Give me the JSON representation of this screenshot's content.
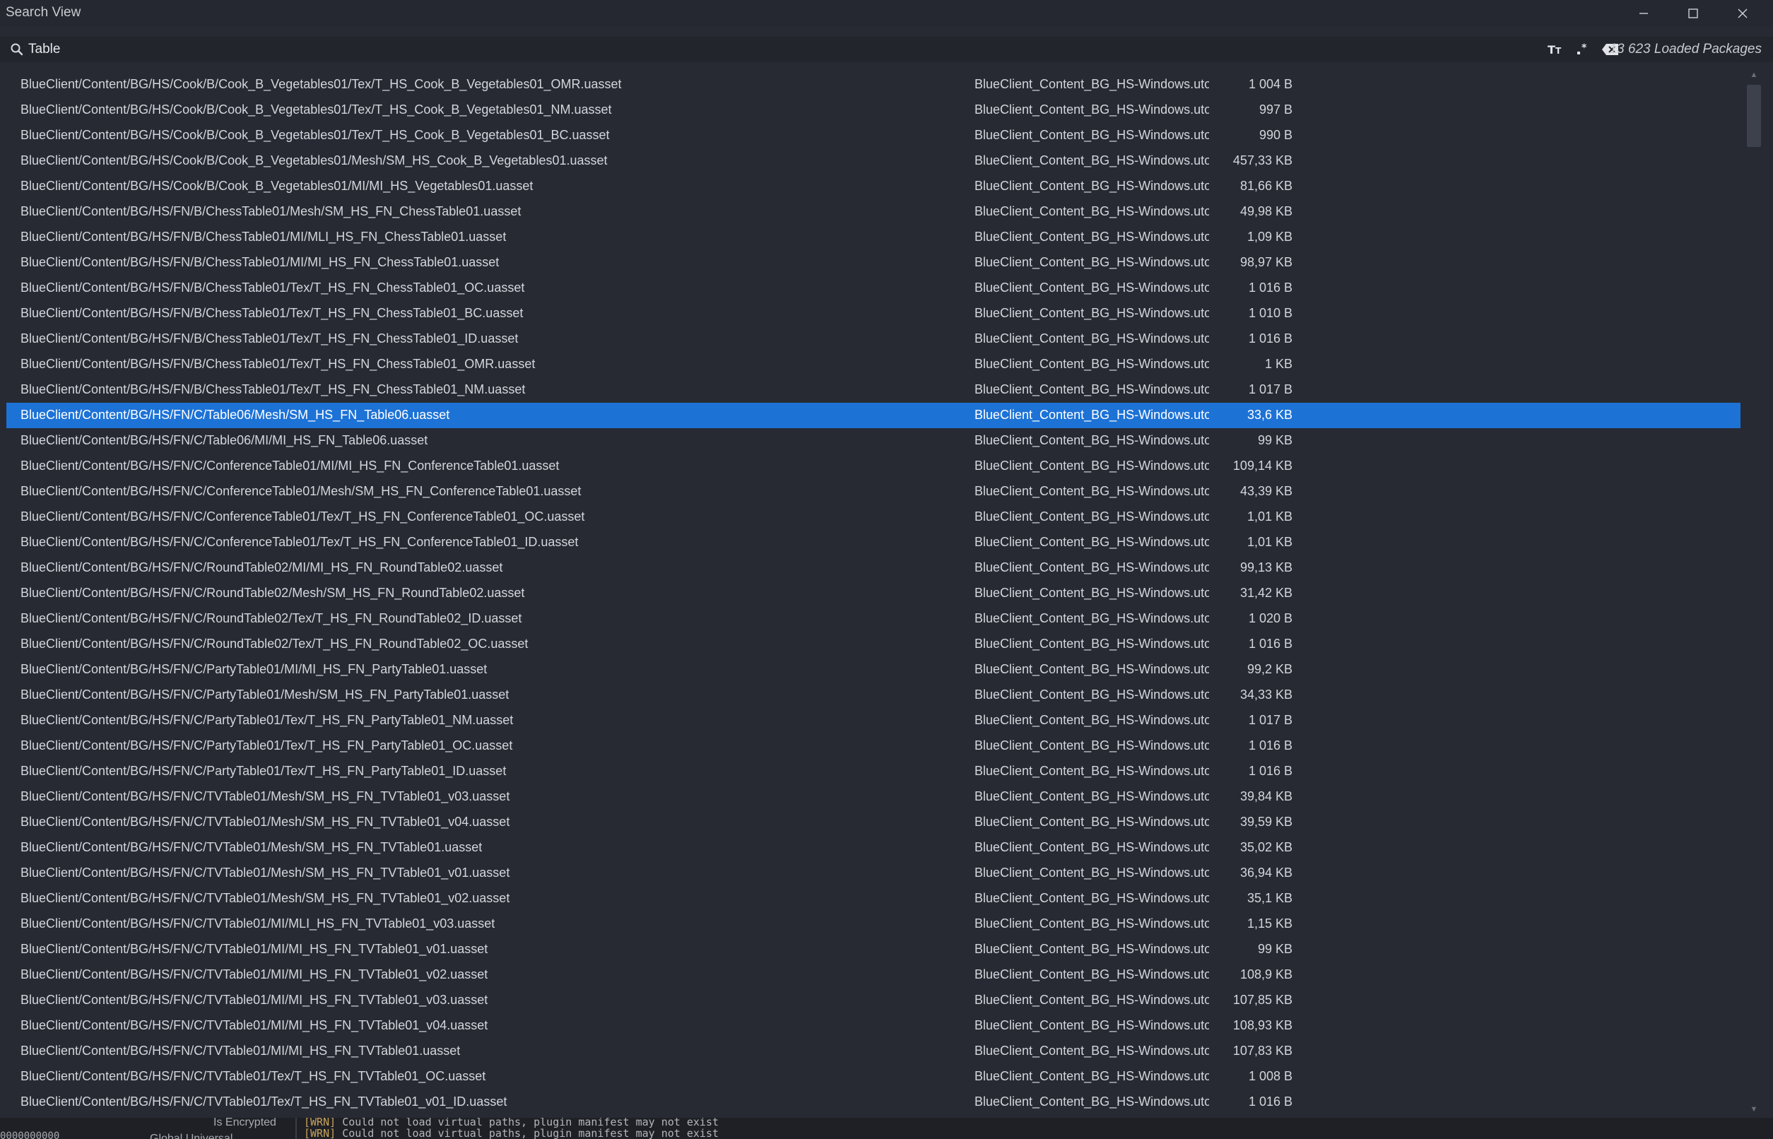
{
  "window": {
    "title": "Search View",
    "minimize_icon": "minimize-icon",
    "maximize_icon": "maximize-icon",
    "close_icon": "close-icon"
  },
  "search": {
    "icon": "search-icon",
    "value": "Table",
    "placeholder": "",
    "match_case_icon": "text-case-icon",
    "regex_icon": "regex-icon",
    "clear_icon": "backspace-clear-icon",
    "loaded_packages": "13 623 Loaded Packages"
  },
  "results": {
    "selected_index": 13,
    "rows": [
      {
        "path": "BlueClient/Content/BG/HS/Cook/B/Cook_B_Vegetables01/Tex/T_HS_Cook_B_Vegetables01_OMR.uasset",
        "package": "BlueClient_Content_BG_HS-Windows.utoc",
        "size": "1 004 B"
      },
      {
        "path": "BlueClient/Content/BG/HS/Cook/B/Cook_B_Vegetables01/Tex/T_HS_Cook_B_Vegetables01_NM.uasset",
        "package": "BlueClient_Content_BG_HS-Windows.utoc",
        "size": "997 B"
      },
      {
        "path": "BlueClient/Content/BG/HS/Cook/B/Cook_B_Vegetables01/Tex/T_HS_Cook_B_Vegetables01_BC.uasset",
        "package": "BlueClient_Content_BG_HS-Windows.utoc",
        "size": "990 B"
      },
      {
        "path": "BlueClient/Content/BG/HS/Cook/B/Cook_B_Vegetables01/Mesh/SM_HS_Cook_B_Vegetables01.uasset",
        "package": "BlueClient_Content_BG_HS-Windows.utoc",
        "size": "457,33 KB"
      },
      {
        "path": "BlueClient/Content/BG/HS/Cook/B/Cook_B_Vegetables01/MI/MI_HS_Vegetables01.uasset",
        "package": "BlueClient_Content_BG_HS-Windows.utoc",
        "size": "81,66 KB"
      },
      {
        "path": "BlueClient/Content/BG/HS/FN/B/ChessTable01/Mesh/SM_HS_FN_ChessTable01.uasset",
        "package": "BlueClient_Content_BG_HS-Windows.utoc",
        "size": "49,98 KB"
      },
      {
        "path": "BlueClient/Content/BG/HS/FN/B/ChessTable01/MI/MLI_HS_FN_ChessTable01.uasset",
        "package": "BlueClient_Content_BG_HS-Windows.utoc",
        "size": "1,09 KB"
      },
      {
        "path": "BlueClient/Content/BG/HS/FN/B/ChessTable01/MI/MI_HS_FN_ChessTable01.uasset",
        "package": "BlueClient_Content_BG_HS-Windows.utoc",
        "size": "98,97 KB"
      },
      {
        "path": "BlueClient/Content/BG/HS/FN/B/ChessTable01/Tex/T_HS_FN_ChessTable01_OC.uasset",
        "package": "BlueClient_Content_BG_HS-Windows.utoc",
        "size": "1 016 B"
      },
      {
        "path": "BlueClient/Content/BG/HS/FN/B/ChessTable01/Tex/T_HS_FN_ChessTable01_BC.uasset",
        "package": "BlueClient_Content_BG_HS-Windows.utoc",
        "size": "1 010 B"
      },
      {
        "path": "BlueClient/Content/BG/HS/FN/B/ChessTable01/Tex/T_HS_FN_ChessTable01_ID.uasset",
        "package": "BlueClient_Content_BG_HS-Windows.utoc",
        "size": "1 016 B"
      },
      {
        "path": "BlueClient/Content/BG/HS/FN/B/ChessTable01/Tex/T_HS_FN_ChessTable01_OMR.uasset",
        "package": "BlueClient_Content_BG_HS-Windows.utoc",
        "size": "1 KB"
      },
      {
        "path": "BlueClient/Content/BG/HS/FN/B/ChessTable01/Tex/T_HS_FN_ChessTable01_NM.uasset",
        "package": "BlueClient_Content_BG_HS-Windows.utoc",
        "size": "1 017 B"
      },
      {
        "path": "BlueClient/Content/BG/HS/FN/C/Table06/Mesh/SM_HS_FN_Table06.uasset",
        "package": "BlueClient_Content_BG_HS-Windows.utoc",
        "size": "33,6 KB"
      },
      {
        "path": "BlueClient/Content/BG/HS/FN/C/Table06/MI/MI_HS_FN_Table06.uasset",
        "package": "BlueClient_Content_BG_HS-Windows.utoc",
        "size": "99 KB"
      },
      {
        "path": "BlueClient/Content/BG/HS/FN/C/ConferenceTable01/MI/MI_HS_FN_ConferenceTable01.uasset",
        "package": "BlueClient_Content_BG_HS-Windows.utoc",
        "size": "109,14 KB"
      },
      {
        "path": "BlueClient/Content/BG/HS/FN/C/ConferenceTable01/Mesh/SM_HS_FN_ConferenceTable01.uasset",
        "package": "BlueClient_Content_BG_HS-Windows.utoc",
        "size": "43,39 KB"
      },
      {
        "path": "BlueClient/Content/BG/HS/FN/C/ConferenceTable01/Tex/T_HS_FN_ConferenceTable01_OC.uasset",
        "package": "BlueClient_Content_BG_HS-Windows.utoc",
        "size": "1,01 KB"
      },
      {
        "path": "BlueClient/Content/BG/HS/FN/C/ConferenceTable01/Tex/T_HS_FN_ConferenceTable01_ID.uasset",
        "package": "BlueClient_Content_BG_HS-Windows.utoc",
        "size": "1,01 KB"
      },
      {
        "path": "BlueClient/Content/BG/HS/FN/C/RoundTable02/MI/MI_HS_FN_RoundTable02.uasset",
        "package": "BlueClient_Content_BG_HS-Windows.utoc",
        "size": "99,13 KB"
      },
      {
        "path": "BlueClient/Content/BG/HS/FN/C/RoundTable02/Mesh/SM_HS_FN_RoundTable02.uasset",
        "package": "BlueClient_Content_BG_HS-Windows.utoc",
        "size": "31,42 KB"
      },
      {
        "path": "BlueClient/Content/BG/HS/FN/C/RoundTable02/Tex/T_HS_FN_RoundTable02_ID.uasset",
        "package": "BlueClient_Content_BG_HS-Windows.utoc",
        "size": "1 020 B"
      },
      {
        "path": "BlueClient/Content/BG/HS/FN/C/RoundTable02/Tex/T_HS_FN_RoundTable02_OC.uasset",
        "package": "BlueClient_Content_BG_HS-Windows.utoc",
        "size": "1 016 B"
      },
      {
        "path": "BlueClient/Content/BG/HS/FN/C/PartyTable01/MI/MI_HS_FN_PartyTable01.uasset",
        "package": "BlueClient_Content_BG_HS-Windows.utoc",
        "size": "99,2 KB"
      },
      {
        "path": "BlueClient/Content/BG/HS/FN/C/PartyTable01/Mesh/SM_HS_FN_PartyTable01.uasset",
        "package": "BlueClient_Content_BG_HS-Windows.utoc",
        "size": "34,33 KB"
      },
      {
        "path": "BlueClient/Content/BG/HS/FN/C/PartyTable01/Tex/T_HS_FN_PartyTable01_NM.uasset",
        "package": "BlueClient_Content_BG_HS-Windows.utoc",
        "size": "1 017 B"
      },
      {
        "path": "BlueClient/Content/BG/HS/FN/C/PartyTable01/Tex/T_HS_FN_PartyTable01_OC.uasset",
        "package": "BlueClient_Content_BG_HS-Windows.utoc",
        "size": "1 016 B"
      },
      {
        "path": "BlueClient/Content/BG/HS/FN/C/PartyTable01/Tex/T_HS_FN_PartyTable01_ID.uasset",
        "package": "BlueClient_Content_BG_HS-Windows.utoc",
        "size": "1 016 B"
      },
      {
        "path": "BlueClient/Content/BG/HS/FN/C/TVTable01/Mesh/SM_HS_FN_TVTable01_v03.uasset",
        "package": "BlueClient_Content_BG_HS-Windows.utoc",
        "size": "39,84 KB"
      },
      {
        "path": "BlueClient/Content/BG/HS/FN/C/TVTable01/Mesh/SM_HS_FN_TVTable01_v04.uasset",
        "package": "BlueClient_Content_BG_HS-Windows.utoc",
        "size": "39,59 KB"
      },
      {
        "path": "BlueClient/Content/BG/HS/FN/C/TVTable01/Mesh/SM_HS_FN_TVTable01.uasset",
        "package": "BlueClient_Content_BG_HS-Windows.utoc",
        "size": "35,02 KB"
      },
      {
        "path": "BlueClient/Content/BG/HS/FN/C/TVTable01/Mesh/SM_HS_FN_TVTable01_v01.uasset",
        "package": "BlueClient_Content_BG_HS-Windows.utoc",
        "size": "36,94 KB"
      },
      {
        "path": "BlueClient/Content/BG/HS/FN/C/TVTable01/Mesh/SM_HS_FN_TVTable01_v02.uasset",
        "package": "BlueClient_Content_BG_HS-Windows.utoc",
        "size": "35,1 KB"
      },
      {
        "path": "BlueClient/Content/BG/HS/FN/C/TVTable01/MI/MLI_HS_FN_TVTable01_v03.uasset",
        "package": "BlueClient_Content_BG_HS-Windows.utoc",
        "size": "1,15 KB"
      },
      {
        "path": "BlueClient/Content/BG/HS/FN/C/TVTable01/MI/MI_HS_FN_TVTable01_v01.uasset",
        "package": "BlueClient_Content_BG_HS-Windows.utoc",
        "size": "99 KB"
      },
      {
        "path": "BlueClient/Content/BG/HS/FN/C/TVTable01/MI/MI_HS_FN_TVTable01_v02.uasset",
        "package": "BlueClient_Content_BG_HS-Windows.utoc",
        "size": "108,9 KB"
      },
      {
        "path": "BlueClient/Content/BG/HS/FN/C/TVTable01/MI/MI_HS_FN_TVTable01_v03.uasset",
        "package": "BlueClient_Content_BG_HS-Windows.utoc",
        "size": "107,85 KB"
      },
      {
        "path": "BlueClient/Content/BG/HS/FN/C/TVTable01/MI/MI_HS_FN_TVTable01_v04.uasset",
        "package": "BlueClient_Content_BG_HS-Windows.utoc",
        "size": "108,93 KB"
      },
      {
        "path": "BlueClient/Content/BG/HS/FN/C/TVTable01/MI/MI_HS_FN_TVTable01.uasset",
        "package": "BlueClient_Content_BG_HS-Windows.utoc",
        "size": "107,83 KB"
      },
      {
        "path": "BlueClient/Content/BG/HS/FN/C/TVTable01/Tex/T_HS_FN_TVTable01_OC.uasset",
        "package": "BlueClient_Content_BG_HS-Windows.utoc",
        "size": "1 008 B"
      },
      {
        "path": "BlueClient/Content/BG/HS/FN/C/TVTable01/Tex/T_HS_FN_TVTable01_v01_ID.uasset",
        "package": "BlueClient_Content_BG_HS-Windows.utoc",
        "size": "1 016 B"
      }
    ]
  },
  "bottom_panel": {
    "left_text": "0000000000",
    "left_text_2": "Global Universal",
    "is_encrypted_label": "Is Encrypted",
    "log_lines": [
      {
        "tag": "[WRN]",
        "message": "Could not load virtual paths, plugin manifest may not exist"
      },
      {
        "tag": "[WRN]",
        "message": "Could not load virtual paths, plugin manifest may not exist"
      }
    ]
  },
  "colors": {
    "selection": "#1d72d6",
    "background": "#272a33",
    "warning_tag": "#c9a25a"
  }
}
